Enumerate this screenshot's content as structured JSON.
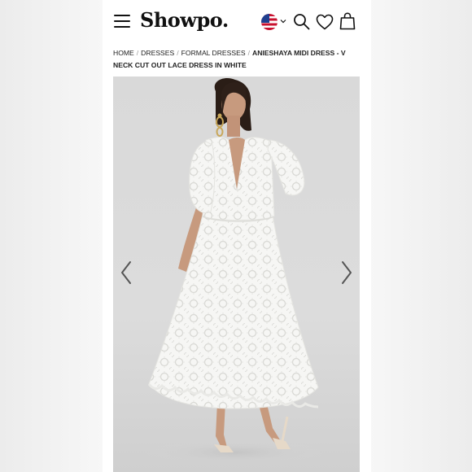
{
  "header": {
    "logo": "Showpo.",
    "menu_icon": "hamburger-menu-icon",
    "flag_icon": "us-flag-icon",
    "search_icon": "search-icon",
    "wishlist_icon": "heart-icon",
    "bag_icon": "shopping-bag-icon"
  },
  "breadcrumb": {
    "items": [
      "HOME",
      "DRESSES",
      "FORMAL DRESSES"
    ],
    "separator": "/",
    "current": "ANIESHAYA MIDI DRESS - V NECK CUT OUT LACE DRESS IN WHITE"
  },
  "gallery": {
    "prev_icon": "chevron-left-icon",
    "next_icon": "chevron-right-icon",
    "colors": {
      "background": "#d9d9d9",
      "dress": "#f6f6f4",
      "skin": "#c79a7e",
      "hair": "#2a1d16"
    }
  }
}
